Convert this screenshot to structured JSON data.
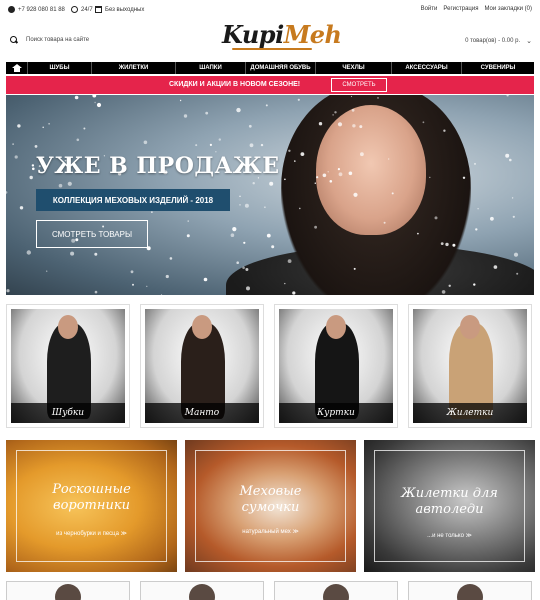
{
  "topbar": {
    "phone": "+7 928 080 81 88",
    "hours": "24/7",
    "days": "Без выходных",
    "login": "Войти",
    "register": "Регистрация",
    "bookmarks": "Мои закладки (0)"
  },
  "header": {
    "logo_part1": "Kupi",
    "logo_part2": "Meh",
    "search_placeholder": "Поиск товара на сайте",
    "cart": "0 товар(ов) - 0.00 р."
  },
  "nav": {
    "items": [
      "ШУБЫ",
      "ЖИЛЕТКИ",
      "ШАПКИ",
      "ДОМАШНЯЯ ОБУВЬ",
      "ЧЕХЛЫ",
      "АКСЕССУАРЫ",
      "СУВЕНИРЫ"
    ]
  },
  "promo": {
    "text": "СКИДКИ И АКЦИИ В НОВОМ СЕЗОНЕ!",
    "button": "СМОТРЕТЬ"
  },
  "hero": {
    "title": "УЖЕ В ПРОДАЖЕ",
    "subtitle": "КОЛЛЕКЦИЯ МЕХОВЫХ ИЗДЕЛИЙ - 2018",
    "button": "СМОТРЕТЬ ТОВАРЫ"
  },
  "categories": [
    {
      "label": "Шубки",
      "coat": "#1e1e1e"
    },
    {
      "label": "Манто",
      "coat": "#2a1f1a"
    },
    {
      "label": "Куртки",
      "coat": "#151515"
    },
    {
      "label": "Жилетки",
      "coat": "#c9a276"
    }
  ],
  "tiles": [
    {
      "line1": "Роскошные",
      "line2": "воротники",
      "sub": "из чернобурки и песца ≫"
    },
    {
      "line1": "Меховые",
      "line2": "сумочки",
      "sub": "натуральный мех ≫"
    },
    {
      "line1": "Жилетки для",
      "line2": "автоледи",
      "sub": "...и не только ≫"
    }
  ]
}
